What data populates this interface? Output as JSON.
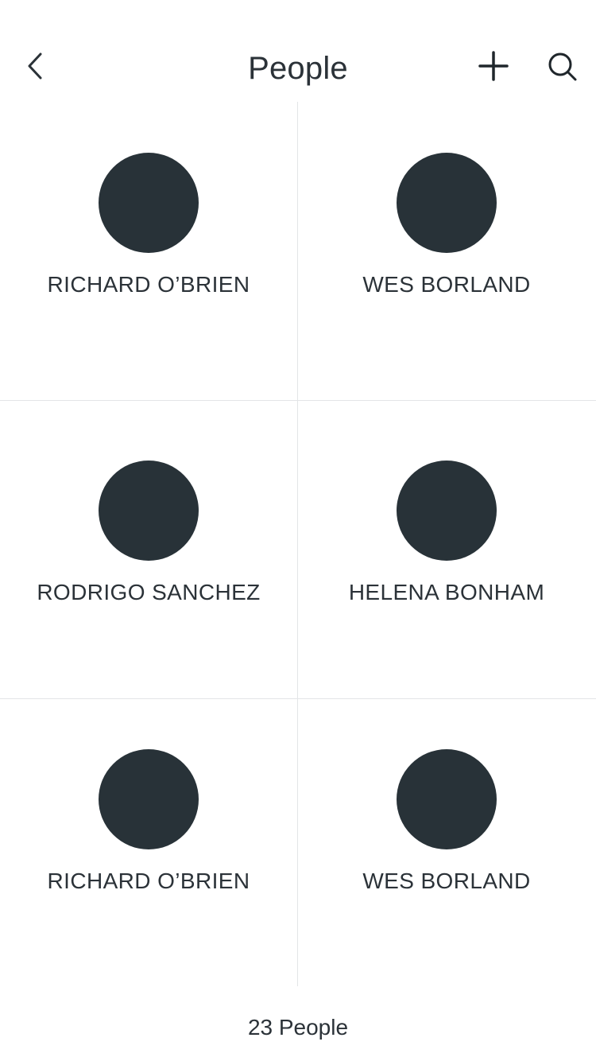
{
  "header": {
    "title": "People",
    "back_icon": "chevron-left-icon",
    "add_icon": "plus-icon",
    "search_icon": "search-icon"
  },
  "colors": {
    "avatar": "#283238",
    "text": "#2b3238",
    "divider": "#e3e5e7",
    "background": "#ffffff"
  },
  "people": [
    {
      "name": "RICHARD O’BRIEN"
    },
    {
      "name": "WES BORLAND"
    },
    {
      "name": "RODRIGO SANCHEZ"
    },
    {
      "name": "HELENA BONHAM"
    },
    {
      "name": "RICHARD O’BRIEN"
    },
    {
      "name": "WES BORLAND"
    }
  ],
  "footer": {
    "count_text": "23 People"
  }
}
